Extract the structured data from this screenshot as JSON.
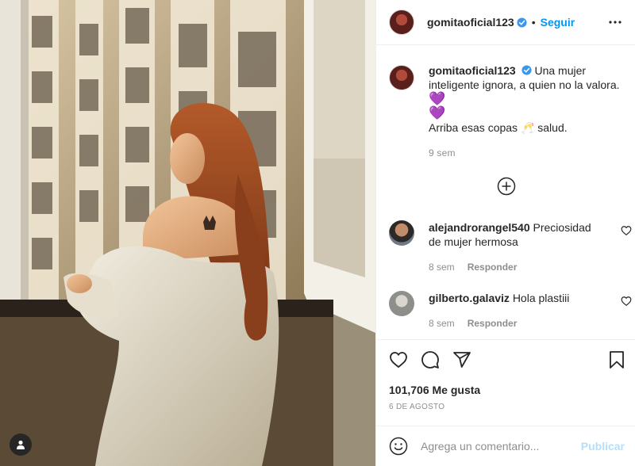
{
  "post": {
    "username": "gomitaoficial123",
    "follow_label": "Seguir",
    "dot": "•",
    "caption_line1": "Una mujer inteligente ignora, a quien no la valora.",
    "caption_hearts": [
      "💜",
      "💜"
    ],
    "caption_line2": "Arriba esas copas 🥂 salud.",
    "caption_time": "9 sem"
  },
  "comments": [
    {
      "username": "alejandrorangel540",
      "text": "Preciosidad de mujer hermosa",
      "time": "8 sem",
      "reply_label": "Responder"
    },
    {
      "username": "gilberto.galaviz",
      "text": "Hola plastiii",
      "time": "8 sem",
      "reply_label": "Responder"
    }
  ],
  "actions": {
    "likes": "101,706 Me gusta",
    "date": "6 DE AGOSTO"
  },
  "add_comment": {
    "placeholder": "Agrega un comentario...",
    "publish_label": "Publicar"
  },
  "colors": {
    "accent": "#0095f6",
    "publish_disabled": "#b2dffc",
    "muted": "#8e8e8e"
  },
  "icons": [
    "verified-icon",
    "more-options-icon",
    "load-more-icon",
    "heart-icon",
    "comment-icon",
    "share-icon",
    "bookmark-icon",
    "emoji-icon",
    "user-tag-icon"
  ]
}
